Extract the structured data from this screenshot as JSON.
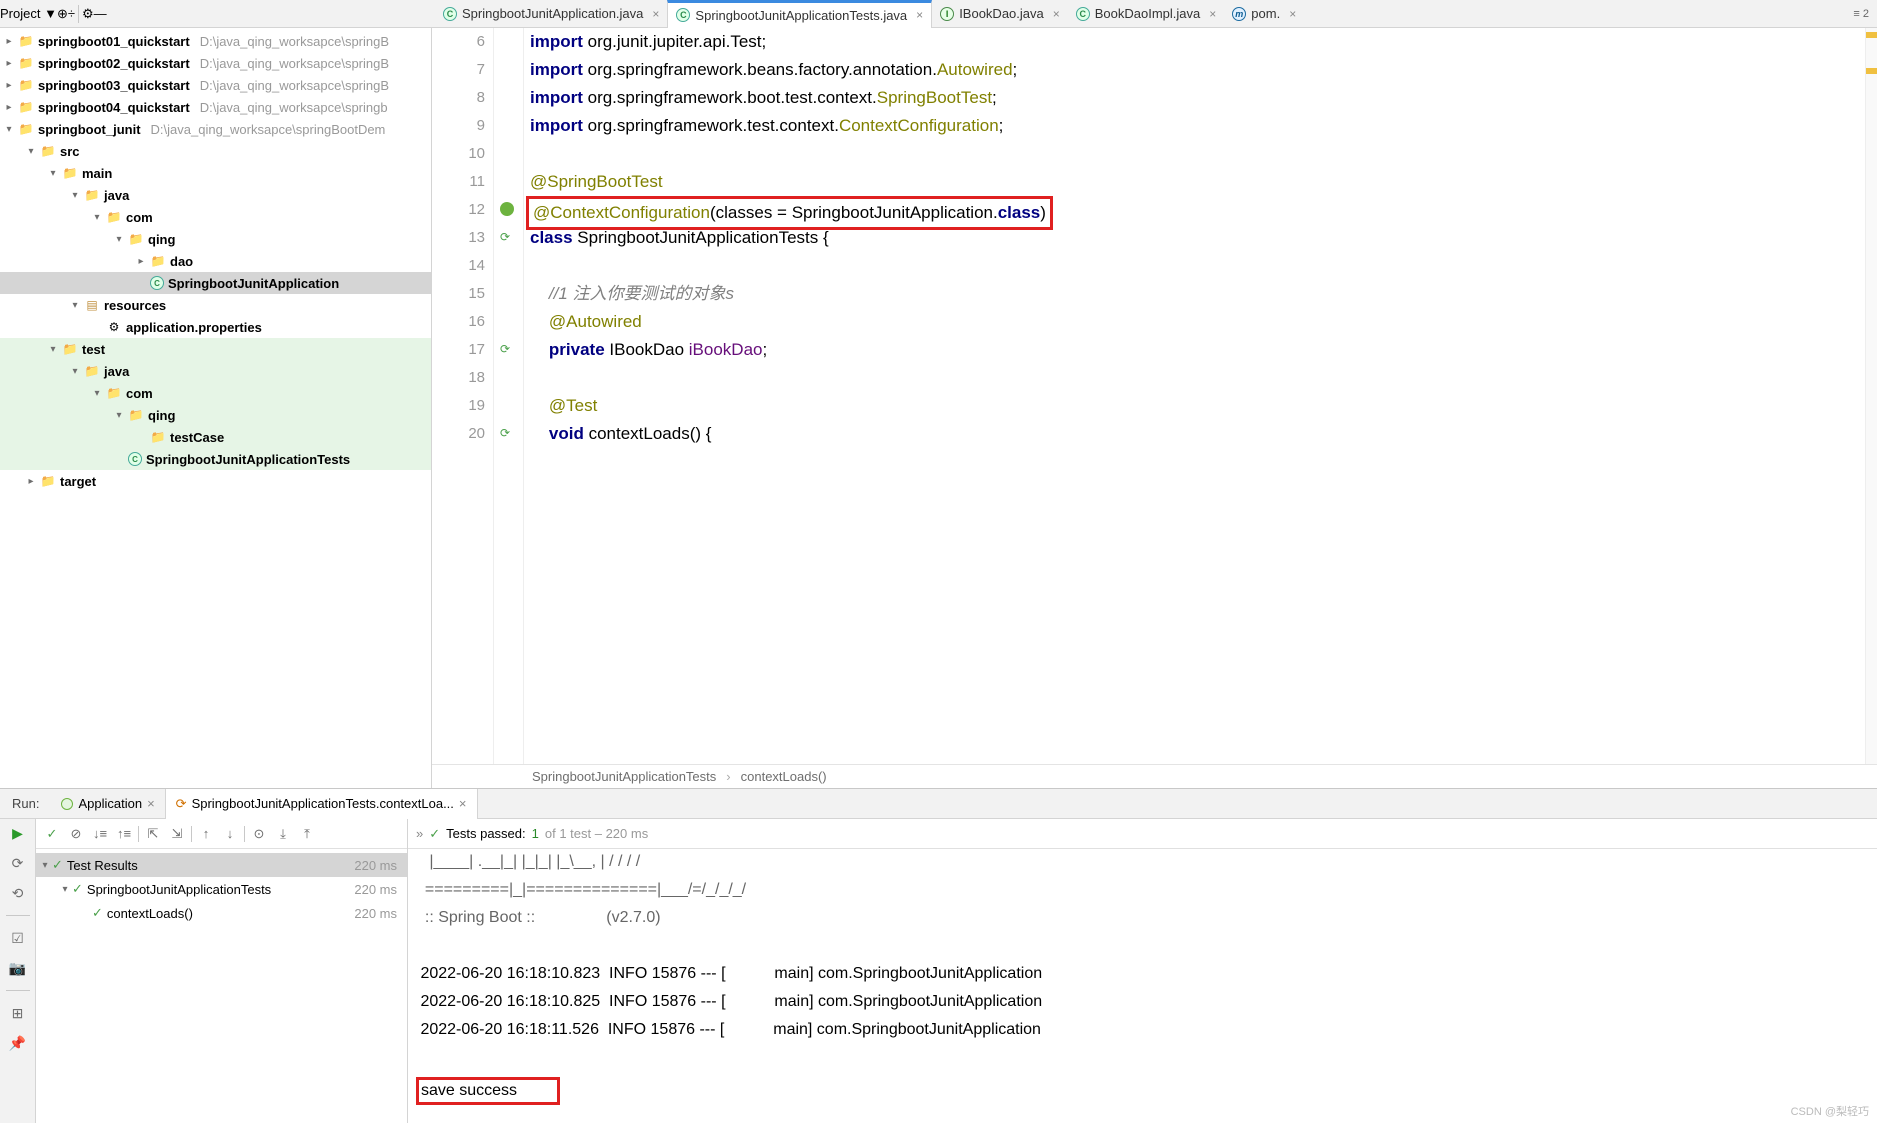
{
  "project": {
    "label": "Project",
    "roots": [
      {
        "name": "springboot01_quickstart",
        "path": "D:\\java_qing_worksapce\\springB"
      },
      {
        "name": "springboot02_quickstart",
        "path": "D:\\java_qing_worksapce\\springB"
      },
      {
        "name": "springboot03_quickstart",
        "path": "D:\\java_qing_worksapce\\springB"
      },
      {
        "name": "springboot04_quickstart",
        "path": "D:\\java_qing_worksapce\\springb"
      }
    ],
    "active_root": {
      "name": "springboot_junit",
      "path": "D:\\java_qing_worksapce\\springBootDem"
    },
    "tree": {
      "src": "src",
      "main": "main",
      "java_main": "java",
      "com": "com",
      "qing": "qing",
      "dao": "dao",
      "app_class": "SpringbootJunitApplication",
      "resources": "resources",
      "app_props": "application.properties",
      "test": "test",
      "java_test": "java",
      "com_t": "com",
      "qing_t": "qing",
      "testcase": "testCase",
      "tests_class": "SpringbootJunitApplicationTests",
      "target": "target"
    }
  },
  "tabs": [
    {
      "label": "SpringbootJunitApplication.java",
      "icon": "c"
    },
    {
      "label": "SpringbootJunitApplicationTests.java",
      "icon": "c",
      "active": true
    },
    {
      "label": "IBookDao.java",
      "icon": "i"
    },
    {
      "label": "BookDaoImpl.java",
      "icon": "c"
    },
    {
      "label": "pom.",
      "icon": "m"
    }
  ],
  "tab_tail": "≡ 2",
  "code": {
    "lines": [
      {
        "n": 6,
        "html": "<span class='kw'>import</span> org.junit.jupiter.api.Test;"
      },
      {
        "n": 7,
        "html": "<span class='kw'>import</span> org.springframework.beans.factory.annotation.<span class='ann'>Autowired</span>;"
      },
      {
        "n": 8,
        "html": "<span class='kw'>import</span> org.springframework.boot.test.context.<span class='ann'>SpringBootTest</span>;"
      },
      {
        "n": 9,
        "html": "<span class='kw'>import</span> org.springframework.test.context.<span class='ann'>ContextConfiguration</span>;"
      },
      {
        "n": 10,
        "html": ""
      },
      {
        "n": 11,
        "html": "<span class='ann'>@SpringBootTest</span>"
      },
      {
        "n": 12,
        "redbox": true,
        "html": "<span class='ann'>@ContextConfiguration</span>(classes = SpringbootJunitApplication.<span class='kw'>class</span>)"
      },
      {
        "n": 13,
        "html": "<span class='kw'>class</span> SpringbootJunitApplicationTests {"
      },
      {
        "n": 14,
        "html": ""
      },
      {
        "n": 15,
        "html": "    <span class='com'>//1 注入你要测试的对象s</span>"
      },
      {
        "n": 16,
        "html": "    <span class='ann'>@Autowired</span>"
      },
      {
        "n": 17,
        "html": "    <span class='kw'>private</span> IBookDao <span style='color:#660e7a'>iBookDao</span>;"
      },
      {
        "n": 18,
        "html": ""
      },
      {
        "n": 19,
        "html": "    <span class='ann'>@Test</span>"
      },
      {
        "n": 20,
        "html": "    <span class='kw'>void</span> contextLoads() {"
      }
    ],
    "gutter_icons": {
      "12": "spring",
      "13": "run",
      "17": "run",
      "20": "run"
    }
  },
  "breadcrumb": [
    "SpringbootJunitApplicationTests",
    "contextLoads()"
  ],
  "run": {
    "title": "Run:",
    "tabs": {
      "app": "Application",
      "tests": "SpringbootJunitApplicationTests.contextLoa..."
    },
    "status": {
      "passed_label": "Tests passed:",
      "passed_n": "1",
      "total_text": "of 1 test – 220 ms"
    },
    "tree": {
      "root": "Test Results",
      "root_time": "220 ms",
      "suite": "SpringbootJunitApplicationTests",
      "suite_time": "220 ms",
      "test": "contextLoads()",
      "test_time": "220 ms"
    },
    "console": [
      "   |____| .__|_| |_|_| |_\\__, | / / / /",
      "  =========|_|==============|___/=/_/_/_/",
      "  :: Spring Boot ::                (v2.7.0)",
      "",
      " 2022-06-20 16:18:10.823  INFO 15876 --- [           main] com.SpringbootJunitApplication",
      " 2022-06-20 16:18:10.825  INFO 15876 --- [           main] com.SpringbootJunitApplication",
      " 2022-06-20 16:18:11.526  INFO 15876 --- [           main] com.SpringbootJunitApplication",
      "",
      "save success"
    ]
  },
  "watermark": "CSDN @梨轻巧"
}
